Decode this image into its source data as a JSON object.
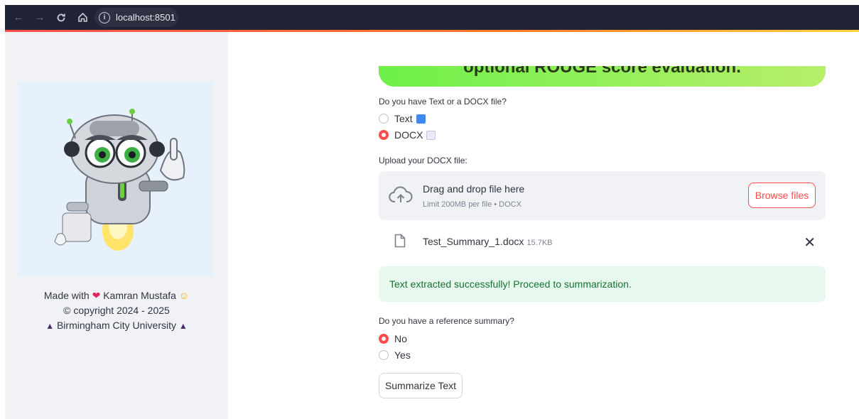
{
  "browser": {
    "url": "localhost:8501",
    "back_icon": "arrow-left-icon",
    "forward_icon": "arrow-right-icon",
    "reload_icon": "reload-icon",
    "home_icon": "home-icon"
  },
  "sidebar": {
    "image": "robot-mascot",
    "made_with": "Made with",
    "author": "Kamran Mustafa",
    "copyright": "© copyright 2024 - 2025",
    "university": "Birmingham City University"
  },
  "main": {
    "banner_text": "optional ROUGE score evaluation.",
    "input_type": {
      "question": "Do you have Text or a DOCX file?",
      "options": [
        "Text",
        "DOCX"
      ],
      "selected": "DOCX"
    },
    "upload": {
      "label": "Upload your DOCX file:",
      "drop_title": "Drag and drop file here",
      "limit": "Limit 200MB per file • DOCX",
      "browse_label": "Browse files"
    },
    "file": {
      "name": "Test_Summary_1.docx",
      "size": "15.7KB"
    },
    "success_message": "Text extracted successfully! Proceed to summarization.",
    "reference": {
      "question": "Do you have a reference summary?",
      "options": [
        "No",
        "Yes"
      ],
      "selected": "No"
    },
    "summarize_label": "Summarize Text"
  },
  "colors": {
    "accent": "#ff4b4b",
    "success_bg": "#e7f8ee",
    "success_text": "#177233",
    "sidebar_bg": "#f0f2f6"
  }
}
